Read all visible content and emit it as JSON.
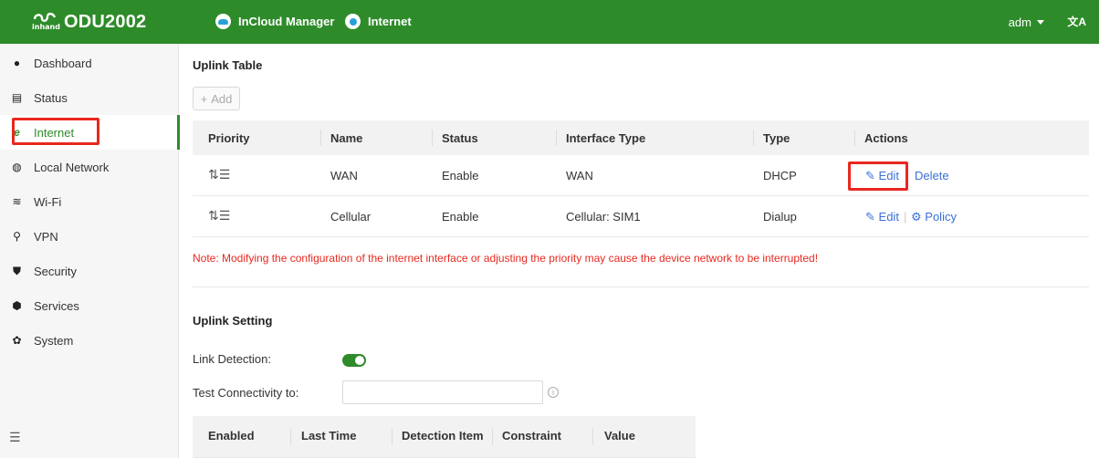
{
  "header": {
    "logo_sub": "inhand",
    "device": "ODU2002",
    "tabs": [
      {
        "label": "InCloud Manager"
      },
      {
        "label": "Internet"
      }
    ],
    "user": "adm",
    "lang_icon": "translate-icon"
  },
  "sidebar": {
    "items": [
      {
        "label": "Dashboard",
        "icon": "dashboard-icon"
      },
      {
        "label": "Status",
        "icon": "status-icon"
      },
      {
        "label": "Internet",
        "icon": "internet-icon"
      },
      {
        "label": "Local Network",
        "icon": "local-network-icon"
      },
      {
        "label": "Wi-Fi",
        "icon": "wifi-icon"
      },
      {
        "label": "VPN",
        "icon": "vpn-icon"
      },
      {
        "label": "Security",
        "icon": "security-icon"
      },
      {
        "label": "Services",
        "icon": "services-icon"
      },
      {
        "label": "System",
        "icon": "system-icon"
      }
    ],
    "active": "Internet"
  },
  "uplink": {
    "title": "Uplink Table",
    "add_label": "Add",
    "columns": [
      "Priority",
      "Name",
      "Status",
      "Interface Type",
      "Type",
      "Actions"
    ],
    "rows": [
      {
        "name": "WAN",
        "status": "Enable",
        "interface_type": "WAN",
        "type": "DHCP",
        "action1": "Edit",
        "action2": "Delete"
      },
      {
        "name": "Cellular",
        "status": "Enable",
        "interface_type": "Cellular: SIM1",
        "type": "Dialup",
        "action1": "Edit",
        "action2": "Policy"
      }
    ],
    "note": "Note: Modifying the configuration of the internet interface or adjusting the priority may cause the device network to be interrupted!"
  },
  "uplink_setting": {
    "title": "Uplink Setting",
    "link_detection_label": "Link Detection:",
    "link_detection_on": true,
    "test_connectivity_label": "Test Connectivity to:",
    "test_connectivity_value": "",
    "columns": [
      "Enabled",
      "Last Time",
      "Detection Item",
      "Constraint",
      "Value"
    ]
  },
  "colors": {
    "brand": "#2e8b2a",
    "link": "#3b6fd8",
    "warning": "#e8281f"
  }
}
